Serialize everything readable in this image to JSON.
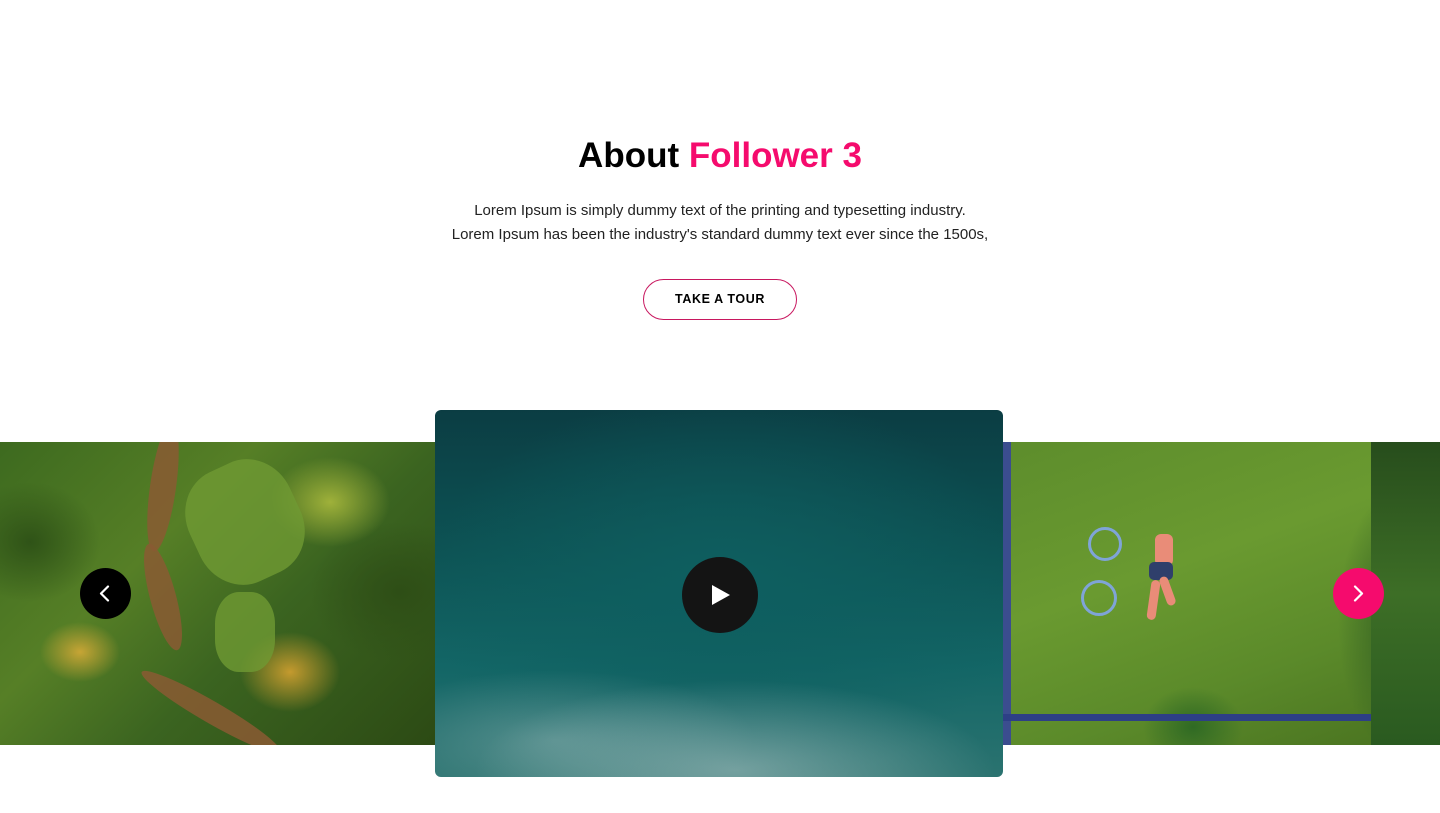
{
  "about": {
    "title_prefix": "About",
    "title_accent": "Follower 3",
    "description_line1": "Lorem Ipsum is simply dummy text of the printing and typesetting industry.",
    "description_line2": "Lorem Ipsum has been the industry's standard dummy text ever since the 1500s,",
    "cta_label": "TAKE A TOUR"
  },
  "slider": {
    "slides": [
      {
        "name": "forest-trail-aerial"
      },
      {
        "name": "ocean-surfer-aerial",
        "has_video": true
      },
      {
        "name": "girl-with-bicycle-on-grass-aerial"
      }
    ],
    "prev_icon": "chevron-left-icon",
    "next_icon": "chevron-right-icon",
    "play_icon": "play-icon"
  },
  "colors": {
    "accent": "#f50b6d",
    "text": "#000000",
    "prev_button": "#000000",
    "next_button": "#f50b6d"
  }
}
